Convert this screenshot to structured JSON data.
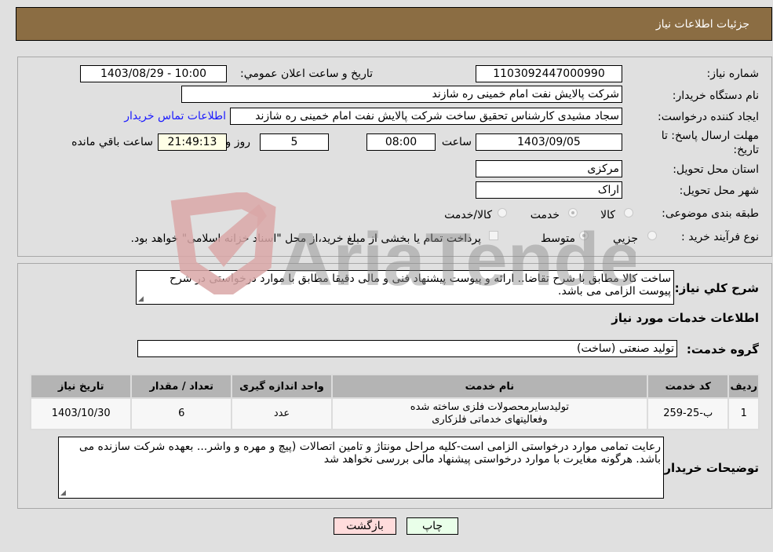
{
  "header": {
    "title": "جزئیات اطلاعات نیاز"
  },
  "form": {
    "need_number_label": "شماره نیاز:",
    "need_number": "1103092447000990",
    "announce_label": "تاریخ و ساعت اعلان عمومي:",
    "announce_value": "1403/08/29 - 10:00",
    "buyer_org_label": "نام دستگاه خریدار:",
    "buyer_org": "شرکت پالایش نفت امام خمینی  ره  شازند",
    "requester_label": "ایجاد کننده درخواست:",
    "requester": "سجاد مشیدی  کارشناس تحقیق ساخت شرکت پالایش نفت امام خمینی  ره  شازند",
    "buyer_contact_link": "اطلاعات تماس خریدار",
    "deadline_label_line1": "مهلت ارسال پاسخ: تا",
    "deadline_label_line2": "تاریخ:",
    "deadline_date": "1403/09/05",
    "time_label": "ساعت",
    "deadline_time": "08:00",
    "days_value": "5",
    "days_label": "روز و",
    "remaining_time": "21:49:13",
    "remaining_label": "ساعت باقي مانده",
    "province_label": "استان محل تحویل:",
    "province": "مرکزی",
    "city_label": "شهر محل تحویل:",
    "city": "اراک",
    "category_label": "طبقه بندی موضوعی:",
    "category_options": [
      {
        "label": "کالا",
        "checked": false
      },
      {
        "label": "خدمت",
        "checked": true
      },
      {
        "label": "کالا/خدمت",
        "checked": false
      }
    ],
    "process_label": "نوع فرآیند خرید :",
    "process_options": [
      {
        "label": "جزيي",
        "checked": false
      },
      {
        "label": "متوسط",
        "checked": true
      }
    ],
    "treasury_note": "پرداخت تمام یا بخشی از مبلغ خرید،از محل \"اسناد خزانه اسلامی\" خواهد بود.",
    "treasury_checked": false
  },
  "description": {
    "label": "شرح کلي نیاز:",
    "text": "ساخت کالا مطابق با شرح تقاضا.. ارائه و پیوست پیشنهاد فنی و مالی دقیقا مطابق با موارد درخواستی در شرح پیوست الزامی می باشد."
  },
  "services": {
    "section_title": "اطلاعات خدمات مورد نیاز",
    "group_label": "گروه خدمت:",
    "group_value": "تولید صنعتی (ساخت)",
    "table": {
      "headers": [
        "ردیف",
        "کد خدمت",
        "نام خدمت",
        "واحد اندازه گیری",
        "تعداد / مقدار",
        "تاریخ نیاز"
      ],
      "rows": [
        [
          "1",
          "ب-25-259",
          "تولیدسایرمحصولات فلزی ساخته شده وفعالیتهای خدماتی فلزکاری",
          "عدد",
          "6",
          "1403/10/30"
        ]
      ]
    }
  },
  "buyer_notes": {
    "label": "توضیحات خریدار:",
    "text": "رعایت تمامی موارد درخواستی الزامی است-کلیه مراحل مونتاژ و تامین اتصالات (پیچ و مهره و واشر... بعهده شرکت سازنده می باشد. هرگونه مغایرت با موارد درخواستی پیشنهاد مالی بررسی نخواهد شد"
  },
  "buttons": {
    "print": "چاپ",
    "back": "بازگشت"
  },
  "watermark": {
    "text": "AriaTender.neT"
  },
  "colors": {
    "header": "#8b6d43",
    "link": "#1a1aff",
    "print_bg": "#e9ffe9",
    "back_bg": "#ffdcdc"
  }
}
